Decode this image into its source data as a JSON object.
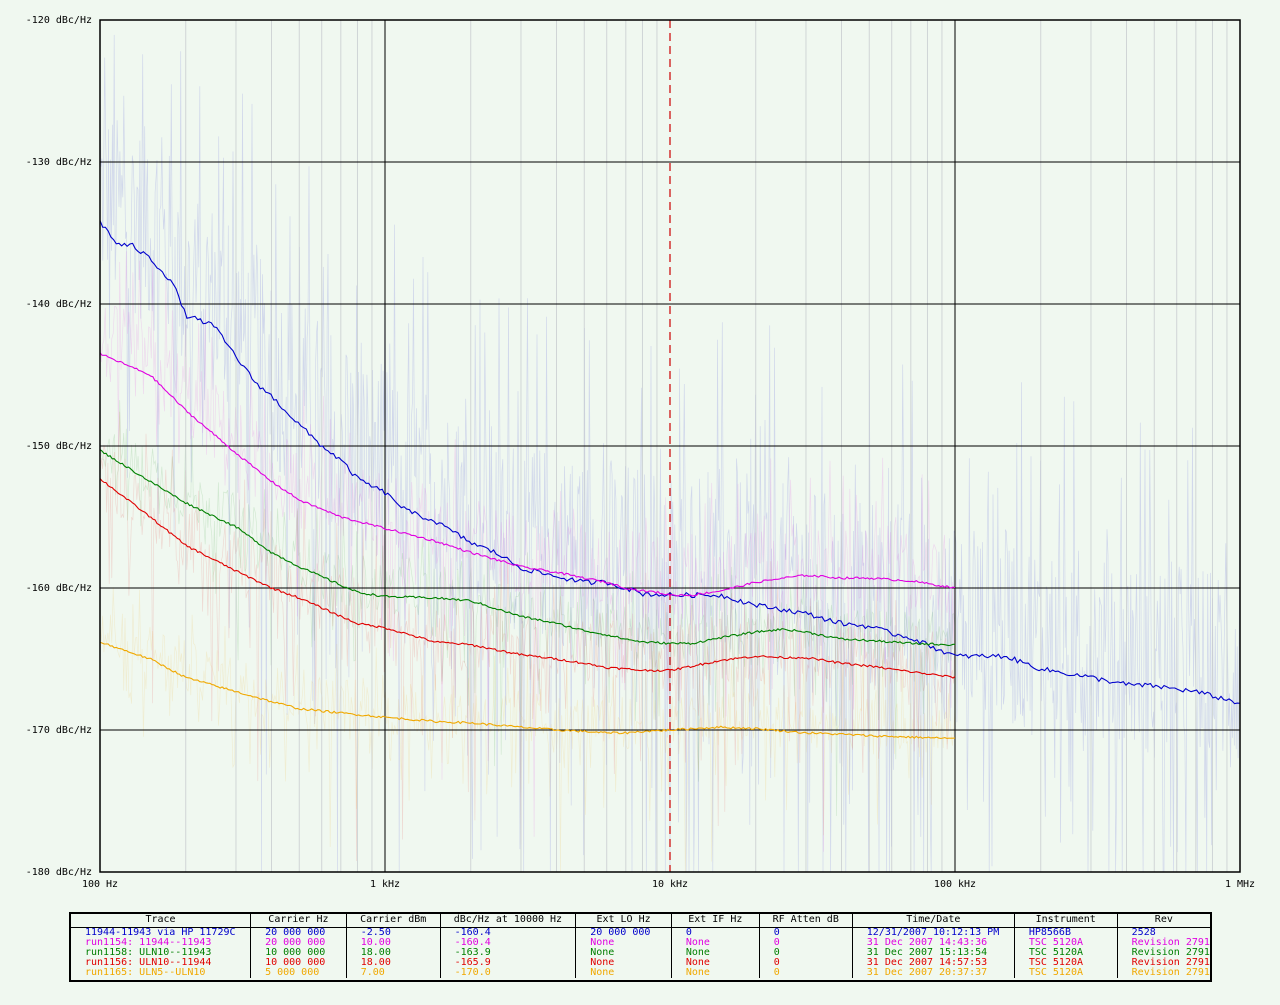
{
  "chart_data": {
    "type": "line",
    "xscale": "log",
    "xlim": [
      100,
      1000000
    ],
    "ylim": [
      -180,
      -120
    ],
    "x_ticks": [
      "100 Hz",
      "1 kHz",
      "10 kHz",
      "100 kHz",
      "1 MHz"
    ],
    "y_ticks": [
      "-120 dBc/Hz",
      "-130 dBc/Hz",
      "-140 dBc/Hz",
      "-150 dBc/Hz",
      "-160 dBc/Hz",
      "-170 dBc/Hz",
      "-180 dBc/Hz"
    ],
    "marker_x": 10000,
    "grid": true,
    "series": [
      {
        "name": "11944-11943 via HP 11729C",
        "color": "#0000cc",
        "x": [
          100,
          115,
          130,
          150,
          180,
          200,
          250,
          300,
          350,
          400,
          500,
          600,
          700,
          800,
          1000,
          1200,
          1500,
          2000,
          2500,
          3000,
          4000,
          5000,
          6000,
          7000,
          8000,
          10000,
          15000,
          20000,
          30000,
          40000,
          50000,
          60000,
          70000,
          80000,
          100000,
          150000,
          200000,
          300000,
          400000,
          500000,
          700000,
          1000000
        ],
        "y": [
          -134.2,
          -135.8,
          -135.9,
          -136.8,
          -138.5,
          -140.8,
          -141.5,
          -143.7,
          -145.5,
          -146.5,
          -148.5,
          -150,
          -151,
          -152.3,
          -153.3,
          -154.6,
          -155.3,
          -156.8,
          -157.6,
          -158.6,
          -159.2,
          -159.6,
          -159.6,
          -160,
          -160.4,
          -160.5,
          -160.5,
          -161.2,
          -161.8,
          -162.5,
          -162.7,
          -163.2,
          -163.5,
          -164,
          -164.8,
          -164.8,
          -165.7,
          -166.3,
          -166.8,
          -166.9,
          -167.3,
          -168.1
        ]
      },
      {
        "name": "run1154: 11944--11943",
        "color": "#e000e0",
        "x": [
          100,
          150,
          200,
          300,
          400,
          500,
          700,
          1000,
          1500,
          2000,
          3000,
          4000,
          5000,
          6000,
          7000,
          8000,
          9000,
          10000,
          12000,
          15000,
          20000,
          25000,
          30000,
          40000,
          50000,
          70000,
          100000
        ],
        "y": [
          -143.5,
          -145,
          -147.5,
          -150.5,
          -152.5,
          -153.8,
          -155,
          -155.8,
          -156.7,
          -157.5,
          -158.5,
          -158.9,
          -159.3,
          -159.6,
          -160,
          -160.2,
          -160.3,
          -160.5,
          -160.5,
          -160.2,
          -159.6,
          -159.3,
          -159.1,
          -159.3,
          -159.3,
          -159.5,
          -160
        ]
      },
      {
        "name": "run1158: ULN10--11943",
        "color": "#008000",
        "x": [
          100,
          150,
          200,
          300,
          400,
          500,
          600,
          700,
          800,
          1000,
          1500,
          2000,
          3000,
          4000,
          5000,
          6000,
          7000,
          8000,
          10000,
          12000,
          15000,
          20000,
          25000,
          30000,
          40000,
          50000,
          70000,
          100000
        ],
        "y": [
          -150.3,
          -152.5,
          -154,
          -155.7,
          -157.5,
          -158.5,
          -159.2,
          -159.8,
          -160.3,
          -160.6,
          -160.7,
          -160.9,
          -162,
          -162.5,
          -163,
          -163.3,
          -163.6,
          -163.8,
          -163.9,
          -163.9,
          -163.5,
          -163.1,
          -162.9,
          -163.1,
          -163.6,
          -163.7,
          -163.9,
          -164
        ]
      },
      {
        "name": "run1156: ULN10--11944",
        "color": "#e00000",
        "x": [
          100,
          150,
          200,
          300,
          400,
          500,
          600,
          700,
          800,
          1000,
          1500,
          2000,
          3000,
          4000,
          5000,
          6000,
          7000,
          8000,
          10000,
          12000,
          15000,
          20000,
          25000,
          30000,
          40000,
          50000,
          70000,
          100000
        ],
        "y": [
          -152.3,
          -155,
          -157,
          -158.8,
          -160,
          -160.7,
          -161.4,
          -162,
          -162.5,
          -162.8,
          -163.8,
          -164,
          -164.7,
          -165,
          -165.3,
          -165.6,
          -165.7,
          -165.8,
          -165.8,
          -165.5,
          -165.1,
          -164.8,
          -164.9,
          -164.9,
          -165.3,
          -165.5,
          -165.9,
          -166.3
        ]
      },
      {
        "name": "run1165: ULN5--ULN10",
        "color": "#f0a800",
        "x": [
          100,
          150,
          200,
          300,
          400,
          500,
          700,
          1000,
          1500,
          2000,
          3000,
          4000,
          5000,
          6000,
          7000,
          8000,
          10000,
          12000,
          15000,
          20000,
          30000,
          40000,
          50000,
          70000,
          100000
        ],
        "y": [
          -163.8,
          -165,
          -166.3,
          -167.3,
          -168,
          -168.5,
          -168.8,
          -169.1,
          -169.4,
          -169.5,
          -169.8,
          -170,
          -170.1,
          -170.2,
          -170.2,
          -170.1,
          -170,
          -169.9,
          -169.8,
          -169.9,
          -170.2,
          -170.3,
          -170.4,
          -170.5,
          -170.6
        ]
      }
    ]
  },
  "legend": {
    "headers": [
      "Trace",
      "Carrier Hz",
      "Carrier dBm",
      "dBc/Hz at 10000 Hz",
      "Ext LO Hz",
      "Ext IF Hz",
      "RF Atten dB",
      "Time/Date",
      "Instrument",
      "Rev"
    ],
    "rows": [
      {
        "color": "#0000cc",
        "cells": [
          "11944-11943 via HP 11729C",
          "20 000 000",
          "-2.50",
          "-160.4",
          "20 000 000",
          "0",
          "0",
          "12/31/2007 10:12:13 PM",
          "HP8566B",
          "2528"
        ]
      },
      {
        "color": "#e000e0",
        "cells": [
          "run1154: 11944--11943",
          "20 000 000",
          "10.00",
          "-160.4",
          "None",
          "None",
          "0",
          "31 Dec 2007 14:43:36",
          "TSC 5120A",
          "Revision 2791"
        ]
      },
      {
        "color": "#008000",
        "cells": [
          "run1158: ULN10--11943",
          "10 000 000",
          "18.00",
          "-163.9",
          "None",
          "None",
          "0",
          "31 Dec 2007 15:13:54",
          "TSC 5120A",
          "Revision 2791"
        ]
      },
      {
        "color": "#e00000",
        "cells": [
          "run1156: ULN10--11944",
          "10 000 000",
          "18.00",
          "-165.9",
          "None",
          "None",
          "0",
          "31 Dec 2007 14:57:53",
          "TSC 5120A",
          "Revision 2791"
        ]
      },
      {
        "color": "#f0a800",
        "cells": [
          "run1165: ULN5--ULN10",
          "5 000 000",
          "7.00",
          "-170.0",
          "None",
          "None",
          "0",
          "31 Dec 2007 20:37:37",
          "TSC 5120A",
          "Revision 2791"
        ]
      }
    ]
  }
}
